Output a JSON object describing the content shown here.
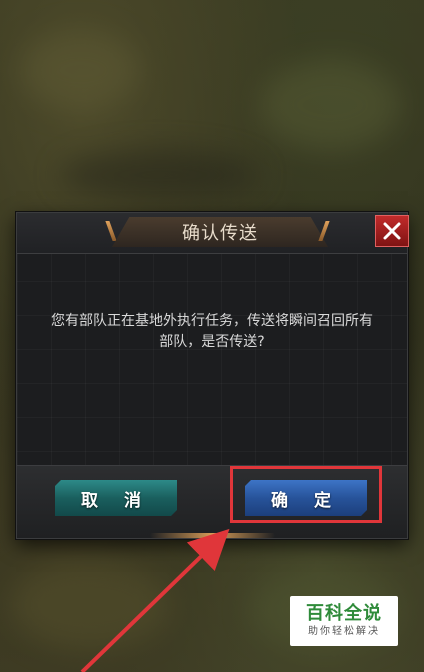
{
  "dialog": {
    "title": "确认传送",
    "message": "您有部队正在基地外执行任务，传送将瞬间召回所有部队，是否传送?",
    "cancel_label": "取 消",
    "confirm_label": "确 定",
    "close_icon": "close-icon"
  },
  "watermark": {
    "main": "百科全说",
    "sub": "助你轻松解决"
  },
  "colors": {
    "cancel_button": "#1a5f5e",
    "confirm_button": "#27539a",
    "close_button": "#a01d1d",
    "highlight": "#e0363a",
    "watermark_green": "#2f8b3a"
  }
}
